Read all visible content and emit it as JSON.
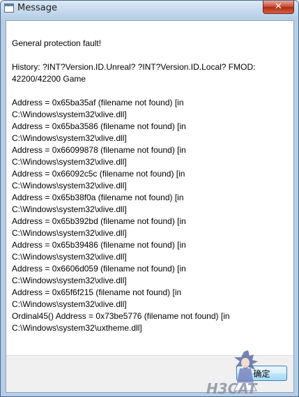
{
  "window": {
    "title": "Message",
    "close_glyph": "✕",
    "icon": "window-app-icon"
  },
  "message": {
    "heading": "General protection fault!",
    "history": "History: ?INT?Version.ID.Unreal? ?INT?Version.ID.Local? FMOD: 42200/42200 Game",
    "trace": [
      "Address = 0x65ba35af (filename not found) [in C:\\Windows\\system32\\xlive.dll]",
      "Address = 0x65ba3586 (filename not found) [in C:\\Windows\\system32\\xlive.dll]",
      "Address = 0x66099878 (filename not found) [in C:\\Windows\\system32\\xlive.dll]",
      "Address = 0x66092c5c (filename not found) [in C:\\Windows\\system32\\xlive.dll]",
      "Address = 0x65b38f0a (filename not found) [in C:\\Windows\\system32\\xlive.dll]",
      "Address = 0x65b392bd (filename not found) [in C:\\Windows\\system32\\xlive.dll]",
      "Address = 0x65b39486 (filename not found) [in C:\\Windows\\system32\\xlive.dll]",
      "Address = 0x6606d059 (filename not found) [in C:\\Windows\\system32\\xlive.dll]",
      "Address = 0x65f6f215 (filename not found) [in C:\\Windows\\system32\\xlive.dll]",
      "Ordinal45() Address = 0x73be5776 (filename not found) [in C:\\Windows\\system32\\uxtheme.dll]"
    ]
  },
  "buttons": {
    "ok_label": "确定"
  },
  "watermark": {
    "text": "H3CAT"
  }
}
